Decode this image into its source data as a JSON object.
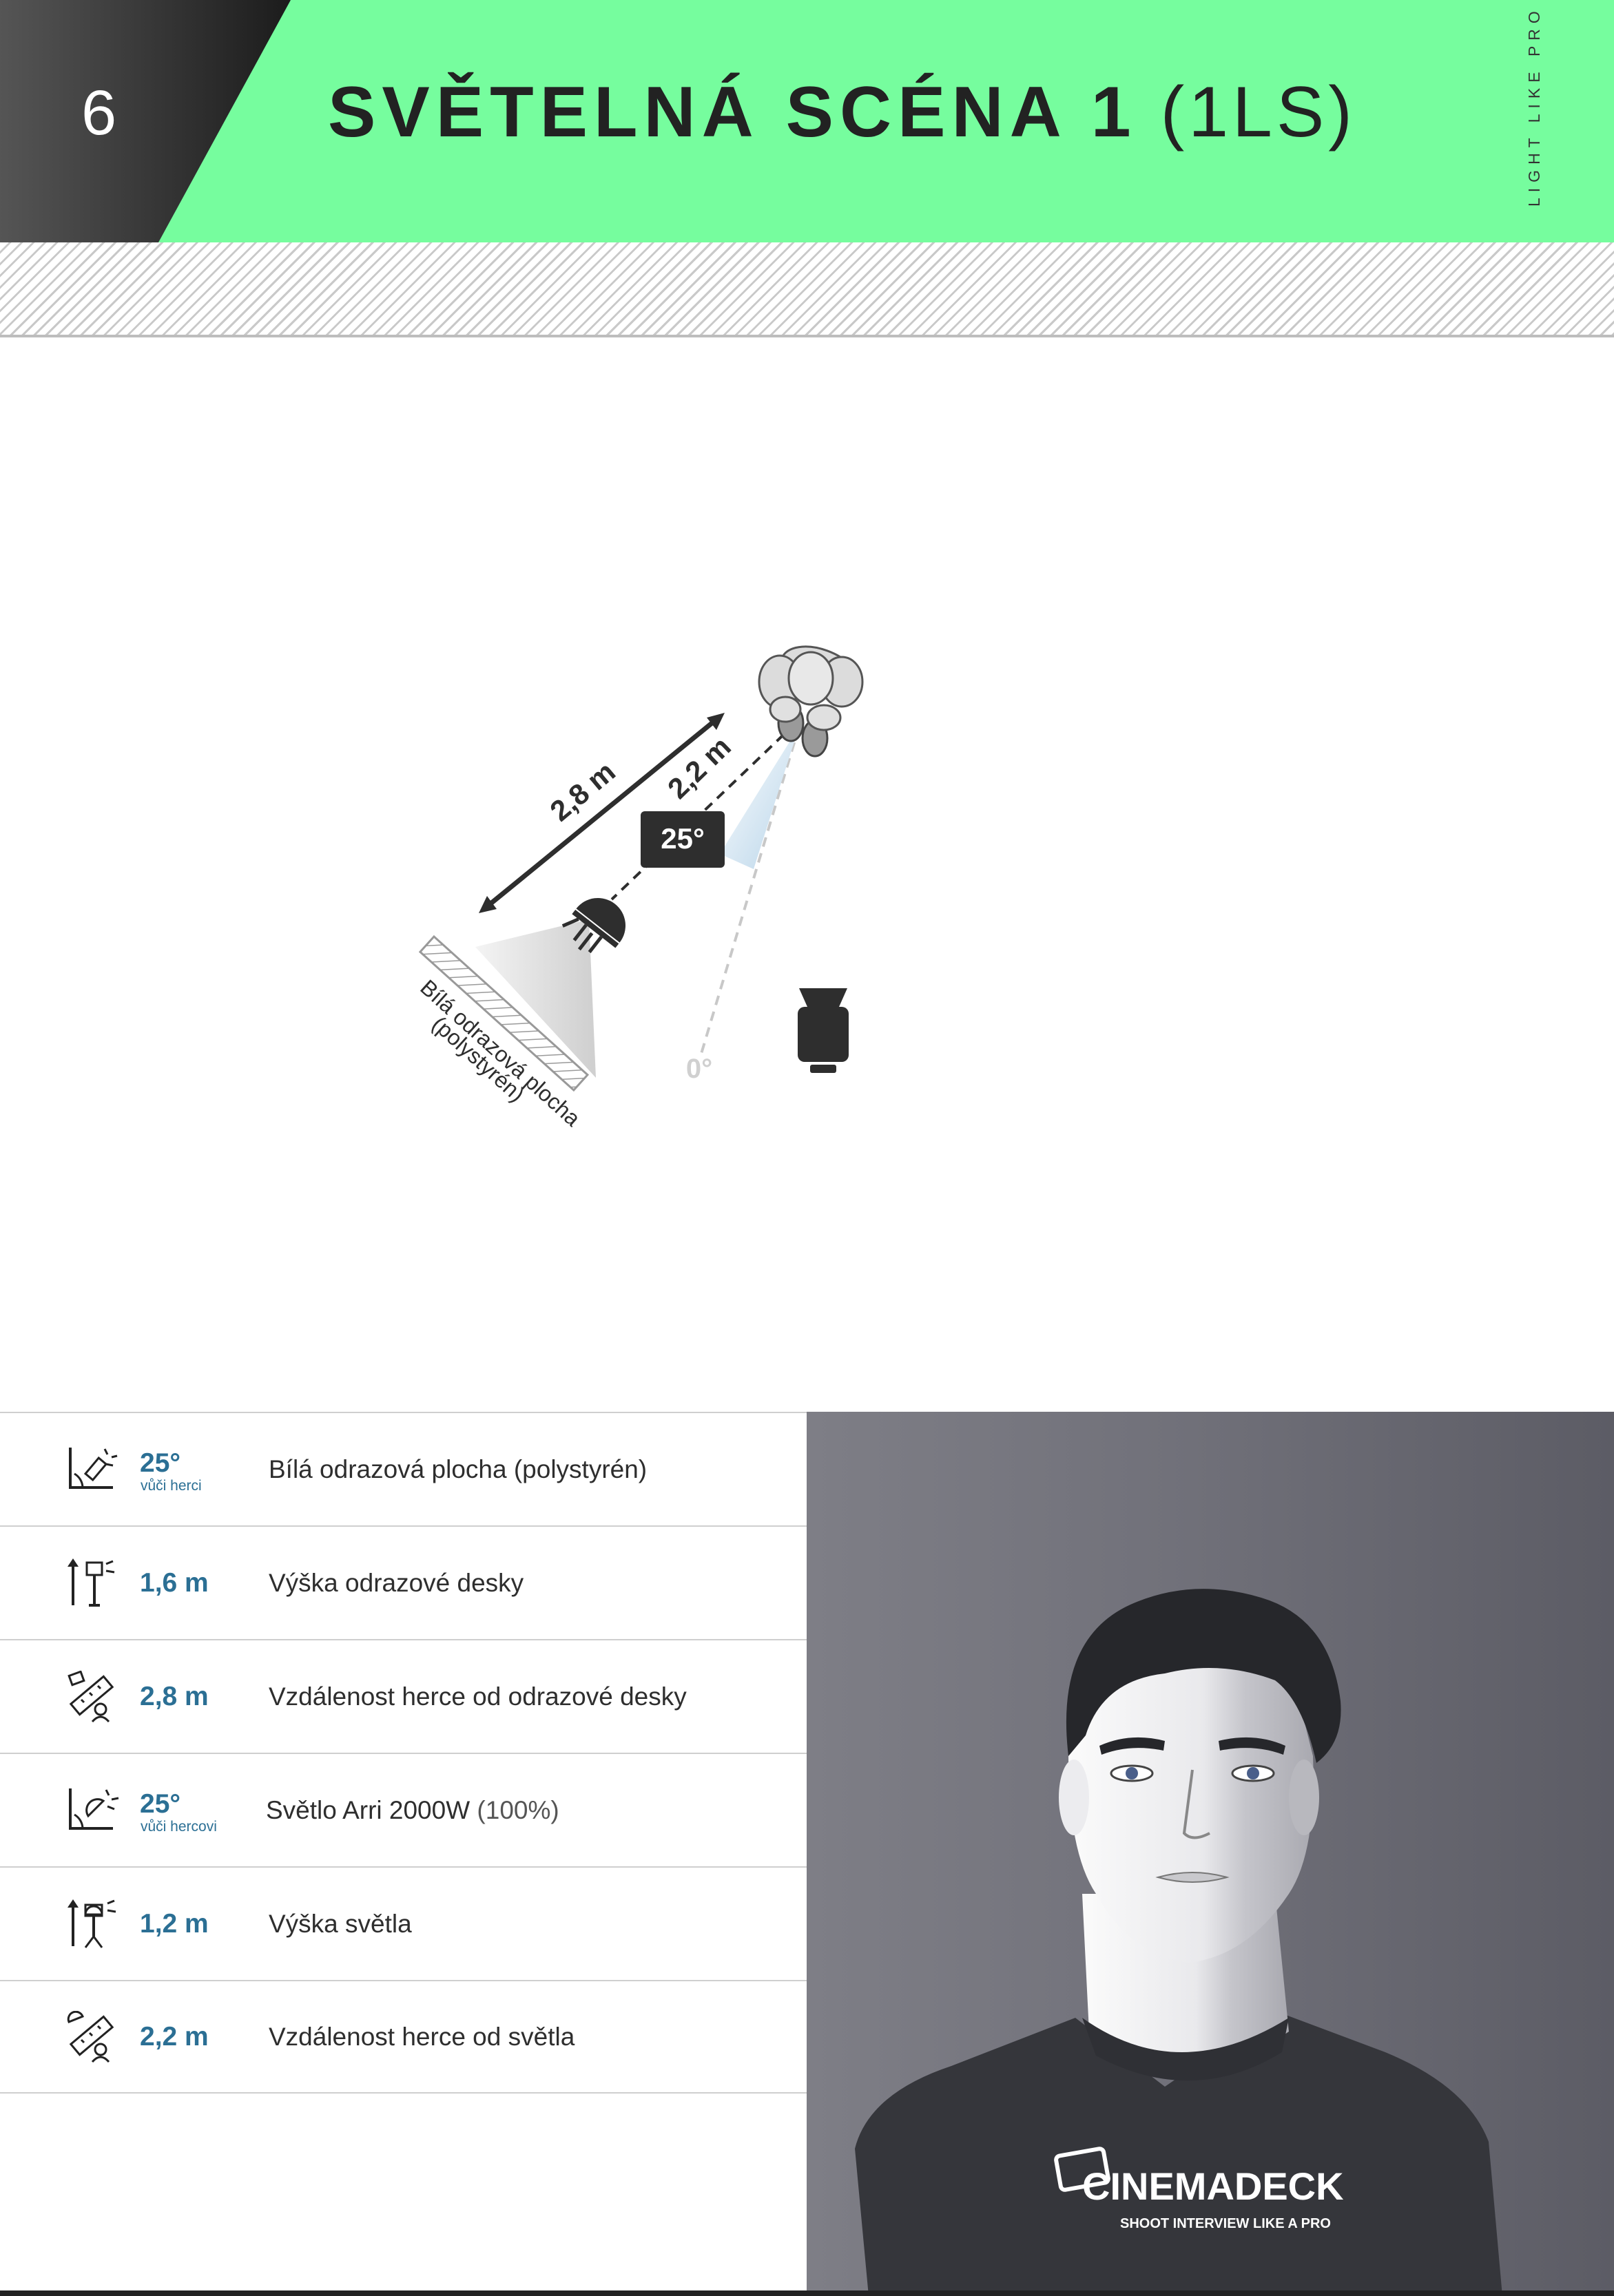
{
  "header": {
    "page_number": "6",
    "title_main": "SVĚTELNÁ SCÉNA 1",
    "title_code": "(1LS)",
    "side_brand": "LIGHT LIKE PRO"
  },
  "diagram": {
    "distance_reflector": "2,8 m",
    "distance_light": "2,2 m",
    "angle_badge": "25°",
    "zero_angle": "0°",
    "reflector_label_line1": "Bílá odrazová plocha",
    "reflector_label_line2": "(polystyrén)"
  },
  "specs": [
    {
      "icon": "reflector-angle-icon",
      "value": "25°",
      "sub": "vůči herci",
      "label": "Bílá odrazová plocha (polystyrén)"
    },
    {
      "icon": "reflector-height-icon",
      "value": "1,6 m",
      "label": "Výška odrazové desky"
    },
    {
      "icon": "reflector-distance-icon",
      "value": "2,8 m",
      "label": "Vzdálenost herce od odrazové desky"
    },
    {
      "icon": "light-angle-icon",
      "value": "25°",
      "sub": "vůči hercovi",
      "label": "Světlo Arri 2000W",
      "note": "(100%)"
    },
    {
      "icon": "light-height-icon",
      "value": "1,2 m",
      "label": "Výška světla"
    },
    {
      "icon": "light-distance-icon",
      "value": "2,2 m",
      "label": "Vzdálenost herce od světla"
    }
  ],
  "portrait": {
    "brand_name": "CINEMADECK",
    "brand_tagline": "SHOOT INTERVIEW LIKE A PRO"
  },
  "colors": {
    "header_green": "#76fd9e",
    "value_blue": "#2b6f94",
    "dark": "#222222"
  }
}
